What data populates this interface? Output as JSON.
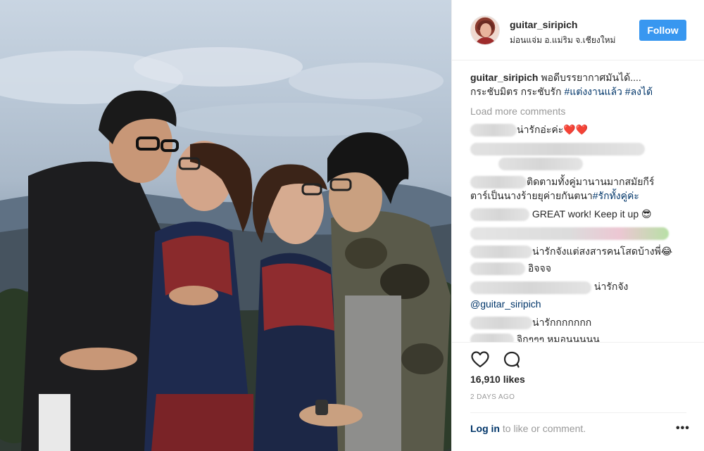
{
  "header": {
    "username": "guitar_siripich",
    "location": "ม่อนแจ่ม อ.แม่ริม จ.เชียงใหม่",
    "follow_label": "Follow"
  },
  "caption": {
    "username": "guitar_siripich",
    "text_1": "พอดีบรรยากาศมันได้....",
    "text_2": "กระชับมิตร กระชับรัก",
    "hashtag_1": "#แต่งงานแล้ว",
    "hashtag_2": "#ลงได้"
  },
  "load_more": "Load more comments",
  "comments": [
    {
      "text": "น่ารักอ่ะค่ะ",
      "emoji": "❤️❤️"
    },
    {
      "text": ""
    },
    {
      "text_1": "ติดตามทั้งคู่มานานมากสมัยกีร์",
      "text_2": "ตาร์เป็นนางร้ายยุค่ายกันตนา",
      "hashtag": "#รักทั้งคู่ค่ะ"
    },
    {
      "text": "GREAT work! Keep it up",
      "emoji": "😎"
    },
    {
      "text": ""
    },
    {
      "text": "น่ารักจังแต่สงสารคนโสดบ้างพี่",
      "emoji": "😂"
    },
    {
      "text": "อิจจจ"
    },
    {
      "text": "น่ารักจัง"
    },
    {
      "mention": "@guitar_siripich"
    },
    {
      "text": "น่ารักกกกกกก"
    },
    {
      "text": "จิกๆๆๆ หมอนนนนน"
    }
  ],
  "stats": {
    "likes": "16,910 likes",
    "time": "2 DAYS AGO"
  },
  "footer": {
    "login_link": "Log in",
    "login_rest": " to like or comment.",
    "more": "•••"
  },
  "icons": {
    "like": "heart-outline-icon",
    "comment": "speech-bubble-icon",
    "more": "more-options-icon"
  },
  "colors": {
    "follow_bg": "#3897f0",
    "link": "#003569",
    "muted": "#999999",
    "text": "#262626"
  }
}
